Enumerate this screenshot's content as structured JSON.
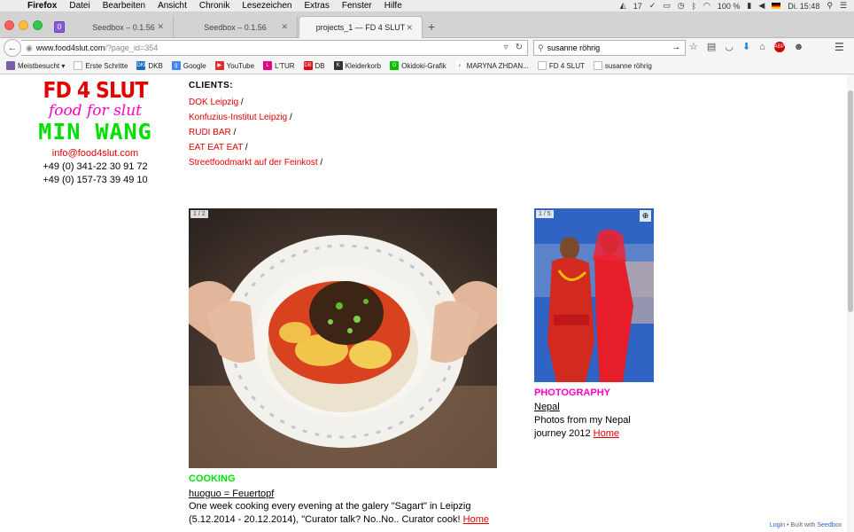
{
  "menubar": {
    "app": "Firefox",
    "items": [
      "Datei",
      "Bearbeiten",
      "Ansicht",
      "Chronik",
      "Lesezeichen",
      "Extras",
      "Fenster",
      "Hilfe"
    ],
    "status": {
      "count": "17",
      "battery": "100 %",
      "clock": "Di. 15:48"
    }
  },
  "tabs": [
    {
      "label": "Seedbox – 0.1.56"
    },
    {
      "label": "Seedbox – 0.1.56"
    },
    {
      "label": "projects_1 — FD 4 SLUT"
    }
  ],
  "urlbar": {
    "domain": "www.food4slut.com",
    "path": "/?page_id=354"
  },
  "searchbar": {
    "value": "susanne röhrig"
  },
  "bookmarks": [
    {
      "label": "Meistbesucht ▾",
      "color": "#7b5ea7"
    },
    {
      "label": "Erste Schritte",
      "color": "#cccccc"
    },
    {
      "label": "DKB",
      "color": "#1a6fc2",
      "icon": "DKB"
    },
    {
      "label": "Google",
      "color": "#4285f4",
      "icon": "g"
    },
    {
      "label": "YouTube",
      "color": "#e52d27",
      "icon": "▶"
    },
    {
      "label": "L'TUR",
      "color": "#e6007e",
      "icon": "L"
    },
    {
      "label": "DB",
      "color": "#e30613",
      "icon": "DB"
    },
    {
      "label": "Kleiderkorb",
      "color": "#333333",
      "icon": "K"
    },
    {
      "label": "Okidoki-Grafik",
      "color": "#00c000",
      "icon": "O"
    },
    {
      "label": "MARYNA ZHDAN...",
      "color": "#222222",
      "icon": "♪"
    },
    {
      "label": "FD 4 SLUT",
      "color": "#cccccc"
    },
    {
      "label": "susanne röhrig",
      "color": "#cccccc"
    }
  ],
  "logo": {
    "line1": "FD 4 SLUT",
    "line2": "food for slut",
    "line3": "MIN WANG",
    "email": "info@food4slut.com",
    "phone1": "+49 (0) 341-22 30 91 72",
    "phone2": "+49 (0) 157-73 39 49 10"
  },
  "clients": {
    "title": "CLIENTS:",
    "items": [
      "DOK Leipzig",
      "Konfuzius-Institut Leipzig",
      "RUDI BAR",
      "EAT EAT EAT",
      "Streetfoodmarkt auf der Feinkost"
    ]
  },
  "cooking": {
    "counter": "1 / 2",
    "category": "COOKING",
    "title": "huoguo = Feuertopf",
    "desc": "One week cooking every evening at the galery \"Sagart\" in Leipzig (5.12.2014 - 20.12.2014), \"Curator talk? No..No.. Curator cook!",
    "home": "Home"
  },
  "photography": {
    "counter": "1 / 5",
    "category": "PHOTOGRAPHY",
    "title": "Nepal",
    "desc": "Photos from my Nepal journey 2012",
    "home": "Home"
  },
  "footer": {
    "login": "Login",
    "built": "Built with",
    "seedbox": "Seedbox"
  }
}
